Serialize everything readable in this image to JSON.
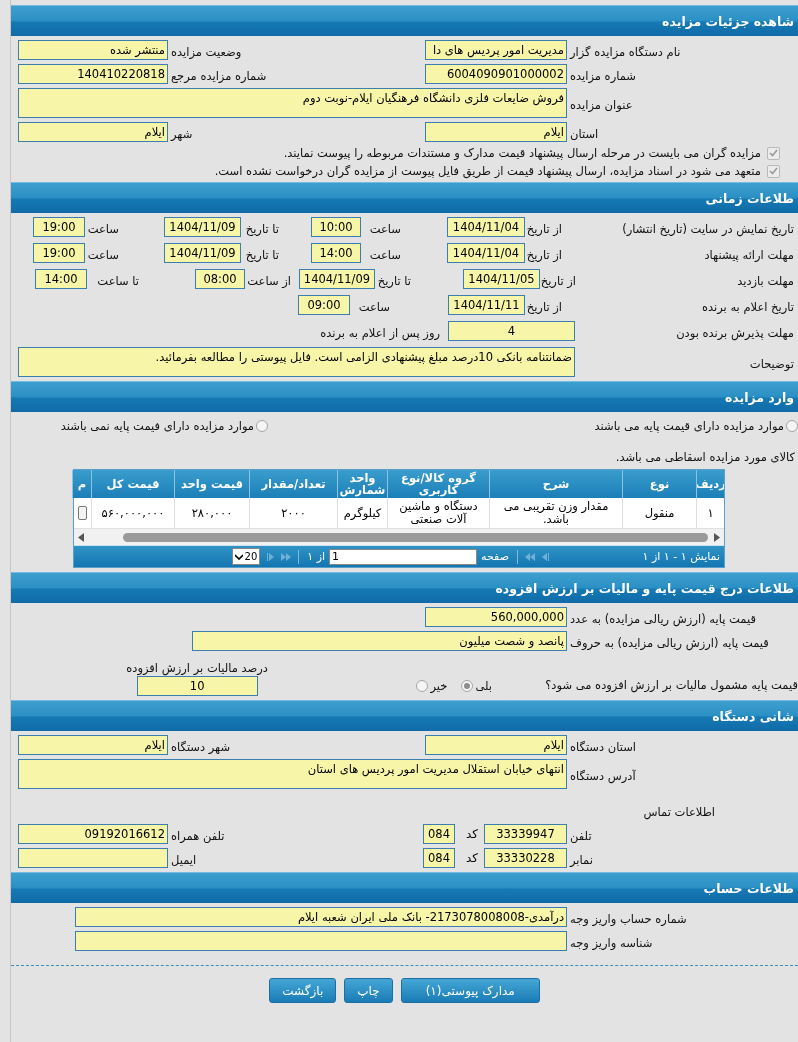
{
  "details": {
    "title": "شاهده جزئیات مزایده",
    "fields": [
      {
        "kind": "half",
        "label": "نام دستگاه مزایده گزار",
        "value": "مدیریت امور پردیس های دا"
      },
      {
        "kind": "half",
        "label": "وضعیت مزایده",
        "value": "منتشر شده"
      },
      {
        "kind": "half",
        "label": "شماره مزایده",
        "value": "6004090901000002"
      },
      {
        "kind": "half",
        "label": "شماره مزایده مرجع",
        "value": "140410220818"
      },
      {
        "kind": "wide",
        "label": "عنوان مزایده",
        "value": "فروش ضایعات فلزی دانشگاه فرهنگیان ایلام-نوبت دوم"
      },
      {
        "kind": "half",
        "label": "استان",
        "value": "ایلام"
      },
      {
        "kind": "half",
        "label": "شهر",
        "value": "ایلام"
      }
    ],
    "checks": [
      {
        "label": "مزایده گران می بایست در مرحله ارسال پیشنهاد قیمت مدارک و مستندات مربوطه را پیوست نمایند.",
        "checked": true,
        "disabled": true
      },
      {
        "label": "متعهد می شود در اسناد مزایده، ارسال پیشنهاد قیمت از طریق فایل پیوست از مزایده گران درخواست نشده است.",
        "checked": true,
        "disabled": true
      }
    ]
  },
  "timing": {
    "title": "طلاعات زمانی",
    "rows": [
      {
        "items": [
          {
            "kind": "label",
            "text": "تاریخ نمایش در سایت (تاریخ انتشار)"
          },
          {
            "kind": "label",
            "text": "از تاریخ"
          },
          {
            "kind": "field",
            "value": "1404/11/04"
          },
          {
            "kind": "label",
            "text": "ساعت"
          },
          {
            "kind": "field",
            "value": "10:00"
          },
          {
            "kind": "label",
            "text": "تا تاریخ"
          },
          {
            "kind": "field",
            "value": "1404/11/09"
          },
          {
            "kind": "label",
            "text": "ساعت"
          },
          {
            "kind": "field",
            "value": "19:00"
          }
        ]
      },
      {
        "items": [
          {
            "kind": "label",
            "text": "مهلت ارائه پیشنهاد"
          },
          {
            "kind": "label",
            "text": "از تاریخ"
          },
          {
            "kind": "field",
            "value": "1404/11/04"
          },
          {
            "kind": "label",
            "text": "ساعت"
          },
          {
            "kind": "field",
            "value": "14:00"
          },
          {
            "kind": "label",
            "text": "تا تاریخ"
          },
          {
            "kind": "field",
            "value": "1404/11/09"
          },
          {
            "kind": "label",
            "text": "ساعت"
          },
          {
            "kind": "field",
            "value": "19:00"
          }
        ]
      },
      {
        "items": [
          {
            "kind": "label",
            "text": "مهلت بازدید"
          },
          {
            "kind": "label",
            "text": "از تاریخ"
          },
          {
            "kind": "field",
            "value": "1404/11/05"
          },
          {
            "kind": "label",
            "text": "تا تاریخ"
          },
          {
            "kind": "field",
            "value": "1404/11/09"
          },
          {
            "kind": "label",
            "text": "از ساعت"
          },
          {
            "kind": "field",
            "value": "08:00"
          },
          {
            "kind": "label",
            "text": "تا ساعت"
          },
          {
            "kind": "field",
            "value": "14:00"
          }
        ]
      },
      {
        "items": [
          {
            "kind": "label",
            "text": "تاریخ اعلام به برنده"
          },
          {
            "kind": "label",
            "text": "از تاریخ"
          },
          {
            "kind": "field",
            "value": "1404/11/11"
          },
          {
            "kind": "label",
            "text": "ساعت"
          },
          {
            "kind": "field",
            "value": "09:00"
          }
        ]
      },
      {
        "items": [
          {
            "kind": "label",
            "text": "مهلت پذیرش برنده بودن"
          },
          {
            "kind": "field",
            "value": "4"
          },
          {
            "kind": "label",
            "text": "روز پس از اعلام به برنده"
          }
        ]
      },
      {
        "items": [
          {
            "kind": "label",
            "text": "توضیحات"
          },
          {
            "kind": "area",
            "value": "ضمانتنامه بانکی 10درصد مبلغ پیشنهادی الزامی است. فایل پیوستی را مطالعه بفرمائید."
          }
        ]
      }
    ]
  },
  "items": {
    "title": "وارد مزایده",
    "options": [
      {
        "label": "موارد مزایده دارای قیمت پایه می باشند",
        "selected": false
      },
      {
        "label": "موارد مزایده دارای فیمت پایه نمی باشند",
        "selected": false
      }
    ],
    "note": "کالای مورد مزایده اسقاطی می باشد.",
    "table": {
      "columns": [
        "ردیف",
        "نوع",
        "شرح",
        "گروه کالا/نوع کاربری",
        "واحد شمارش",
        "تعداد/مقدار",
        "قیمت واحد",
        "قیمت کل",
        "م"
      ],
      "rows": [
        [
          "۱",
          "منقول",
          "مقدار وزن تقریبی می باشد.",
          "دستگاه و ماشین آلات صنعتی",
          "کیلوگرم",
          "۲۰۰۰",
          "۲۸۰,۰۰۰",
          "۵۶۰,۰۰۰,۰۰۰"
        ]
      ]
    },
    "pager": {
      "info": "نمایش ۱ - ۱ از ۱",
      "page_label": "صفحه",
      "page": "1",
      "of": "از ۱",
      "page_size": "20"
    }
  },
  "price": {
    "title": "طلاعات درج قیمت پایه و مالیات بر ارزش افزوده",
    "amount": {
      "label": "قیمت پایه (ارزش ریالی مزایده) به عدد",
      "value": "560,000,000"
    },
    "words": {
      "label": "قیمت پایه (ارزش ریالی مزایده) به حروف",
      "value": "پانصد و شصت میلیون"
    },
    "vat_question": "قیمت پایه مشمول مالیات بر ارزش افزوده می شود؟",
    "vat_options": [
      {
        "label": "بلی",
        "selected": true
      },
      {
        "label": "خیر",
        "selected": false
      }
    ],
    "vat_percent": {
      "label": "درصد مالیات بر ارزش افزوده",
      "value": "10"
    }
  },
  "address": {
    "title": "شانی دستگاه",
    "fields": [
      {
        "kind": "half",
        "label": "استان دستگاه",
        "value": "ایلام"
      },
      {
        "kind": "half",
        "label": "شهر دستگاه",
        "value": "ایلام"
      },
      {
        "kind": "wide",
        "label": "آدرس دستگاه",
        "value": "انتهای خیابان استقلال مدیریت امور پردیس های استان"
      }
    ],
    "contact_title": "اطلاعات تماس",
    "contact": [
      {
        "kind": "phone",
        "label": "تلفن",
        "value": "33339947",
        "code_label": "کد",
        "code": "084"
      },
      {
        "kind": "half",
        "label": "تلفن همراه",
        "value": "09192016612"
      },
      {
        "kind": "phone",
        "label": "نمابر",
        "value": "33330228",
        "code_label": "کد",
        "code": "084"
      },
      {
        "kind": "half",
        "label": "ایمیل"
      }
    ]
  },
  "account": {
    "title": "طلاعات حساب",
    "fields": [
      {
        "label": "شماره حساب واریز وجه",
        "value": "درآمدی-2173078008008- بانک ملی ایران شعبه ایلام"
      },
      {
        "label": "شناسه واریز وجه"
      }
    ]
  },
  "buttons": [
    "مدارک پیوستی(۱)",
    "چاپ",
    "بازگشت"
  ]
}
